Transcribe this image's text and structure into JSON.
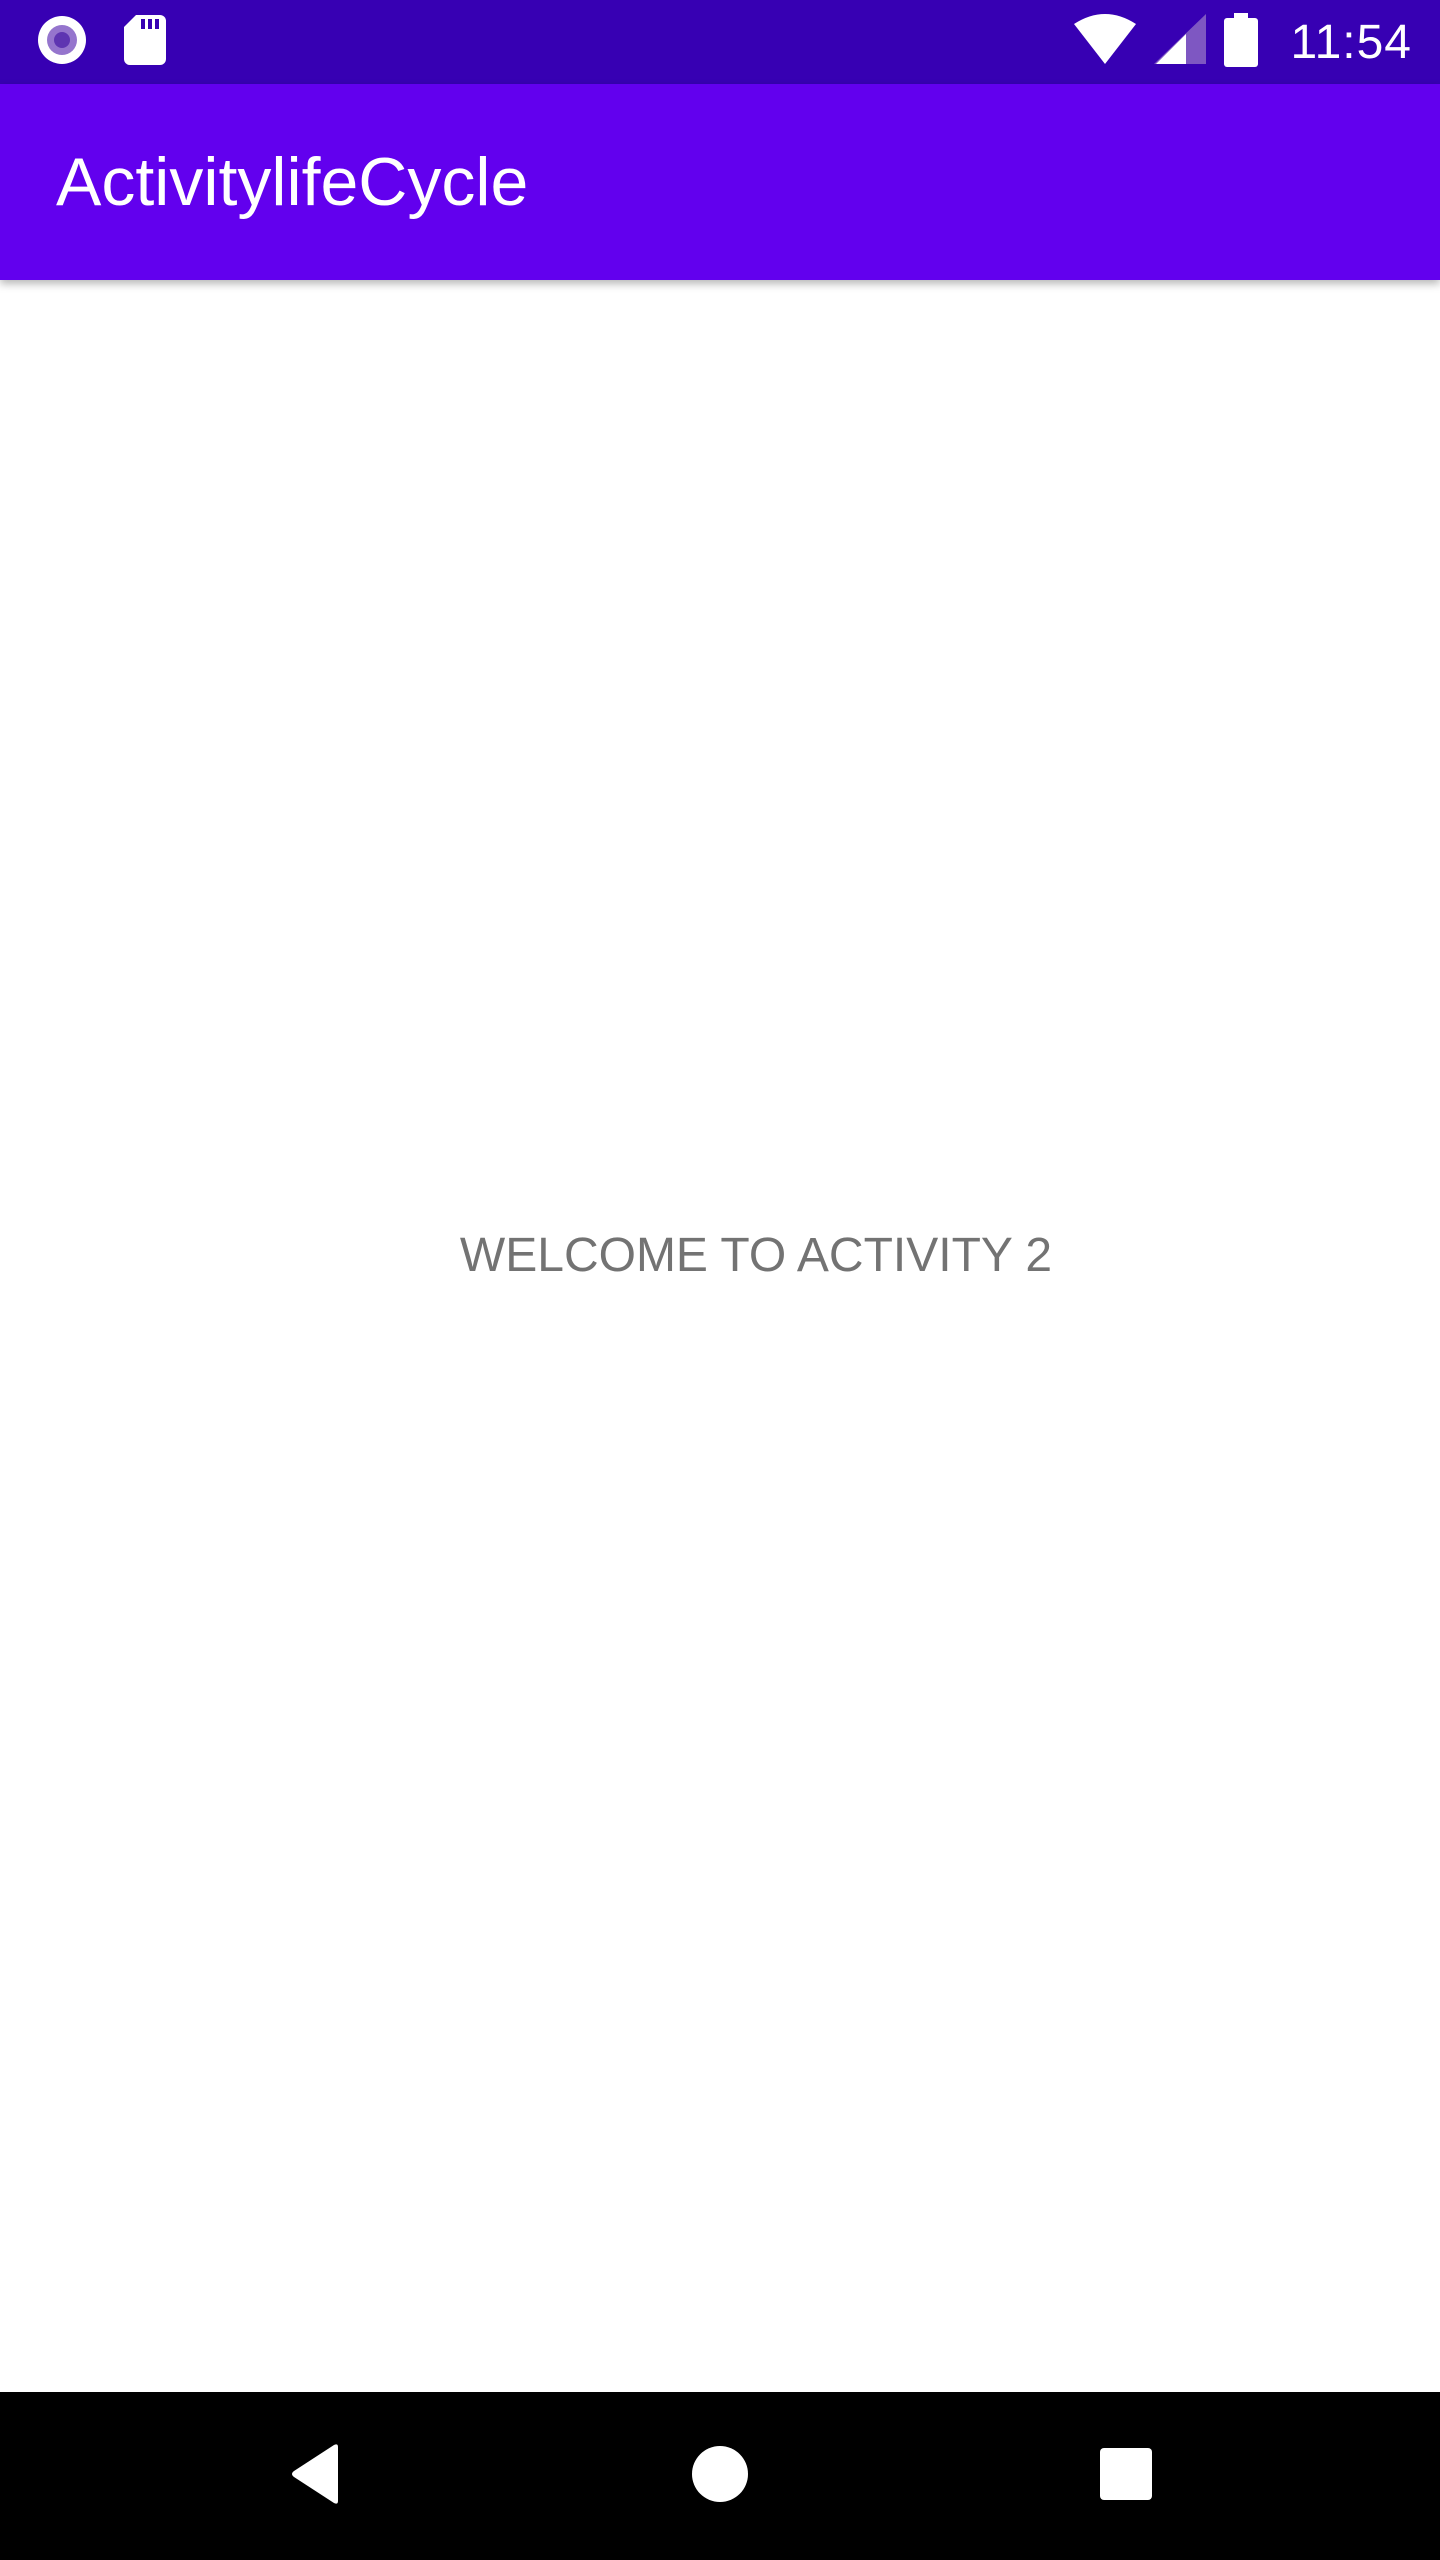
{
  "status_bar": {
    "time": "11:54",
    "left_icons": [
      "radio-button-icon",
      "sd-card-icon"
    ],
    "right_icons": [
      "wifi-icon",
      "cell-signal-icon",
      "battery-icon"
    ],
    "background": "#3700b3"
  },
  "app_bar": {
    "title": "ActivitylifeCycle",
    "background": "#6200ee"
  },
  "content": {
    "message": "WELCOME TO ACTIVITY 2"
  },
  "nav_bar": {
    "buttons": [
      "back-icon",
      "home-icon",
      "recents-icon"
    ]
  }
}
